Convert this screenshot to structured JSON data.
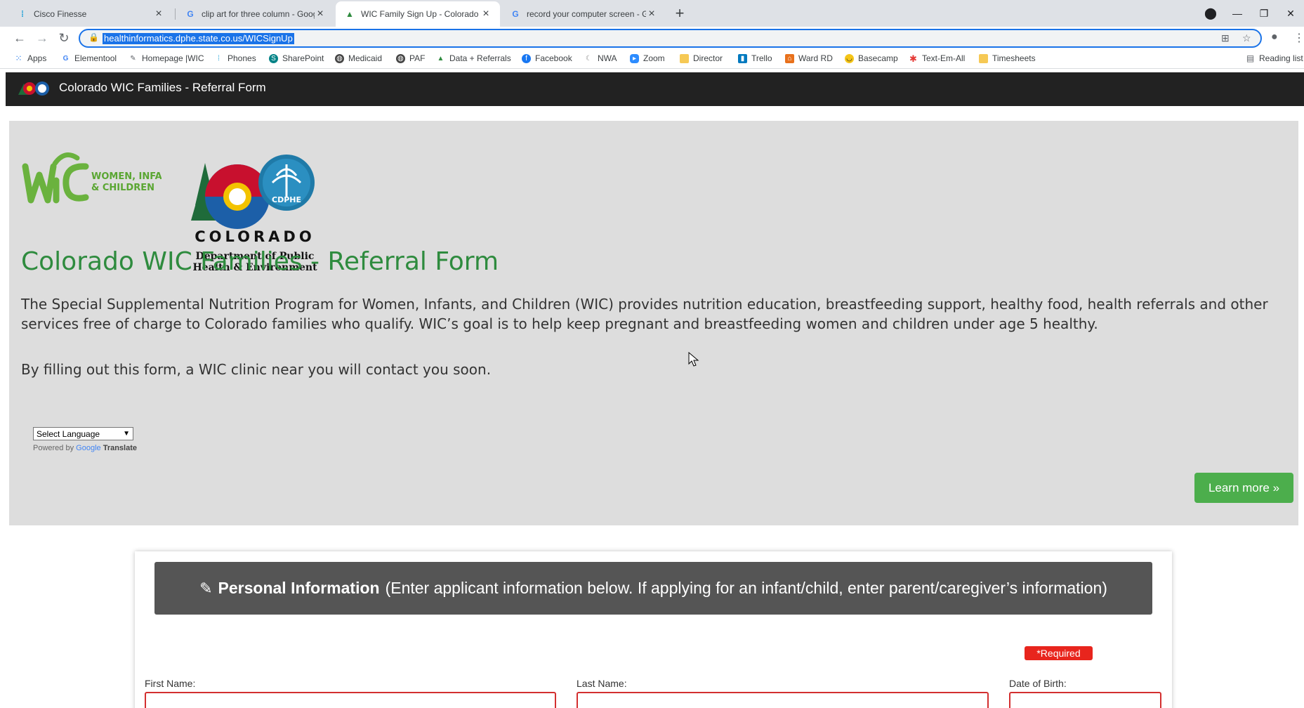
{
  "browser": {
    "tabs": [
      {
        "title": "Cisco Finesse",
        "icon": "cisco-icon"
      },
      {
        "title": "clip art for three column - Googl",
        "icon": "google-icon"
      },
      {
        "title": "WIC Family Sign Up - Colorado D",
        "icon": "wic-icon",
        "active": true
      },
      {
        "title": "record your computer screen - G",
        "icon": "google-icon"
      }
    ],
    "url": "healthinformatics.dphe.state.co.us/WICSignUp",
    "bookmarks": [
      {
        "label": "Apps"
      },
      {
        "label": "Elementool"
      },
      {
        "label": "Homepage |WIC"
      },
      {
        "label": "Phones"
      },
      {
        "label": "SharePoint"
      },
      {
        "label": "Medicaid"
      },
      {
        "label": "PAF"
      },
      {
        "label": "Data + Referrals"
      },
      {
        "label": "Facebook"
      },
      {
        "label": "NWA"
      },
      {
        "label": "Zoom"
      },
      {
        "label": "Director"
      },
      {
        "label": "Trello"
      },
      {
        "label": "Ward RD"
      },
      {
        "label": "Basecamp"
      },
      {
        "label": "Text-Em-All"
      },
      {
        "label": "Timesheets"
      }
    ],
    "reading_list": "Reading list"
  },
  "navbar": {
    "brand": "Colorado WIC Families - Referral Form"
  },
  "hero": {
    "wic_tagline_1": "WOMEN, INFANTS,",
    "wic_tagline_2": "& CHILDREN",
    "co_badge": "CDPHE",
    "co_word": "COLORADO",
    "co_dept_1": "Department of Public",
    "co_dept_2": "Health & Environment",
    "title": "Colorado WIC Families - Referral Form",
    "intro": "The Special Supplemental Nutrition Program for Women, Infants, and Children (WIC) provides nutrition education, breastfeeding support, healthy food, health referrals and other services free of charge to Colorado families who qualify. WIC’s goal is to help keep pregnant and breastfeeding women and children under age 5 healthy.",
    "intro2": "By filling out this form, a WIC clinic near you will contact you soon.",
    "language_select": "Select Language",
    "powered_by": "Powered by",
    "google": "Google",
    "translate": "Translate",
    "learn_more": "Learn more »"
  },
  "form": {
    "section_title": "Personal Information",
    "section_note": "(Enter applicant information below. If applying for an infant/child, enter parent/caregiver’s information)",
    "required": "*Required",
    "first_name": "First Name:",
    "last_name": "Last Name:",
    "dob": "Date of Birth:"
  },
  "colors": {
    "accent_green": "#2e8b3e",
    "button_green": "#4cae4c",
    "navbar": "#222222",
    "required_red": "#e8251d"
  }
}
